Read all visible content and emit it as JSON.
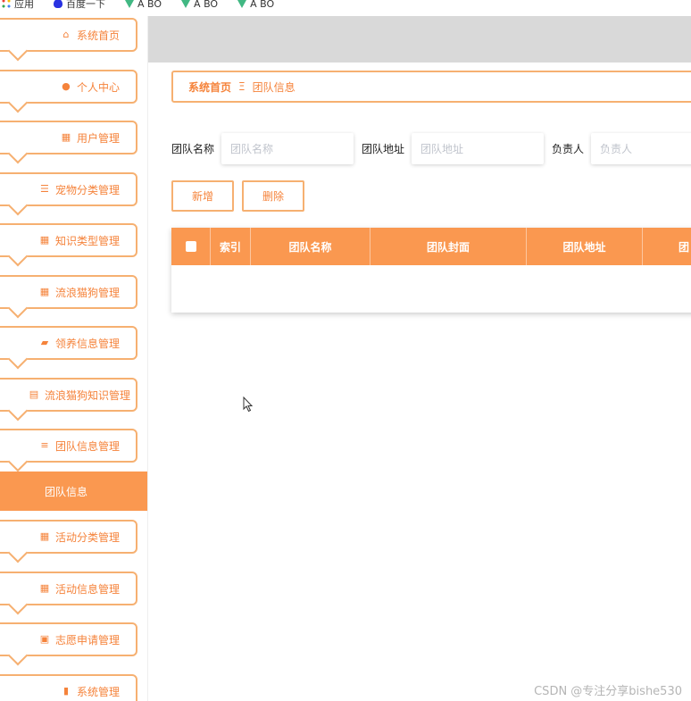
{
  "bookmarks": [
    {
      "label": "应用",
      "icon": "apps-icon"
    },
    {
      "label": "百度一下",
      "icon": "baidu-icon"
    },
    {
      "label": "A BO",
      "icon": "vue-icon"
    },
    {
      "label": "A BO",
      "icon": "vue-icon"
    },
    {
      "label": "A BO",
      "icon": "vue-icon"
    }
  ],
  "sidebar": {
    "items": [
      {
        "label": "系统首页",
        "icon": "home-icon"
      },
      {
        "label": "个人中心",
        "icon": "user-icon"
      },
      {
        "label": "用户管理",
        "icon": "grid-icon"
      },
      {
        "label": "宠物分类管理",
        "icon": "list-icon"
      },
      {
        "label": "知识类型管理",
        "icon": "grid-icon"
      },
      {
        "label": "流浪猫狗管理",
        "icon": "grid-icon"
      },
      {
        "label": "领养信息管理",
        "icon": "ticket-icon"
      },
      {
        "label": "流浪猫狗知识管理",
        "icon": "wallet-icon"
      },
      {
        "label": "团队信息管理",
        "icon": "sliders-icon"
      },
      {
        "label": "活动分类管理",
        "icon": "grid-icon"
      },
      {
        "label": "活动信息管理",
        "icon": "grid-icon"
      },
      {
        "label": "志愿申请管理",
        "icon": "clipboard-icon"
      },
      {
        "label": "系统管理",
        "icon": "bar-chart-icon"
      }
    ],
    "active_sub": "团队信息"
  },
  "breadcrumb": {
    "home": "系统首页",
    "separator": "Ξ",
    "current": "团队信息"
  },
  "search": {
    "name_label": "团队名称",
    "name_placeholder": "团队名称",
    "addr_label": "团队地址",
    "addr_placeholder": "团队地址",
    "owner_label": "负责人",
    "owner_placeholder": "负责人"
  },
  "buttons": {
    "add": "新增",
    "delete": "删除"
  },
  "table": {
    "columns": [
      "索引",
      "团队名称",
      "团队封面",
      "团队地址",
      "团"
    ]
  },
  "watermark": "CSDN @专注分享bishe530",
  "colors": {
    "accent": "#fa9850",
    "border": "#f6b071",
    "text_accent": "#f5833b"
  }
}
